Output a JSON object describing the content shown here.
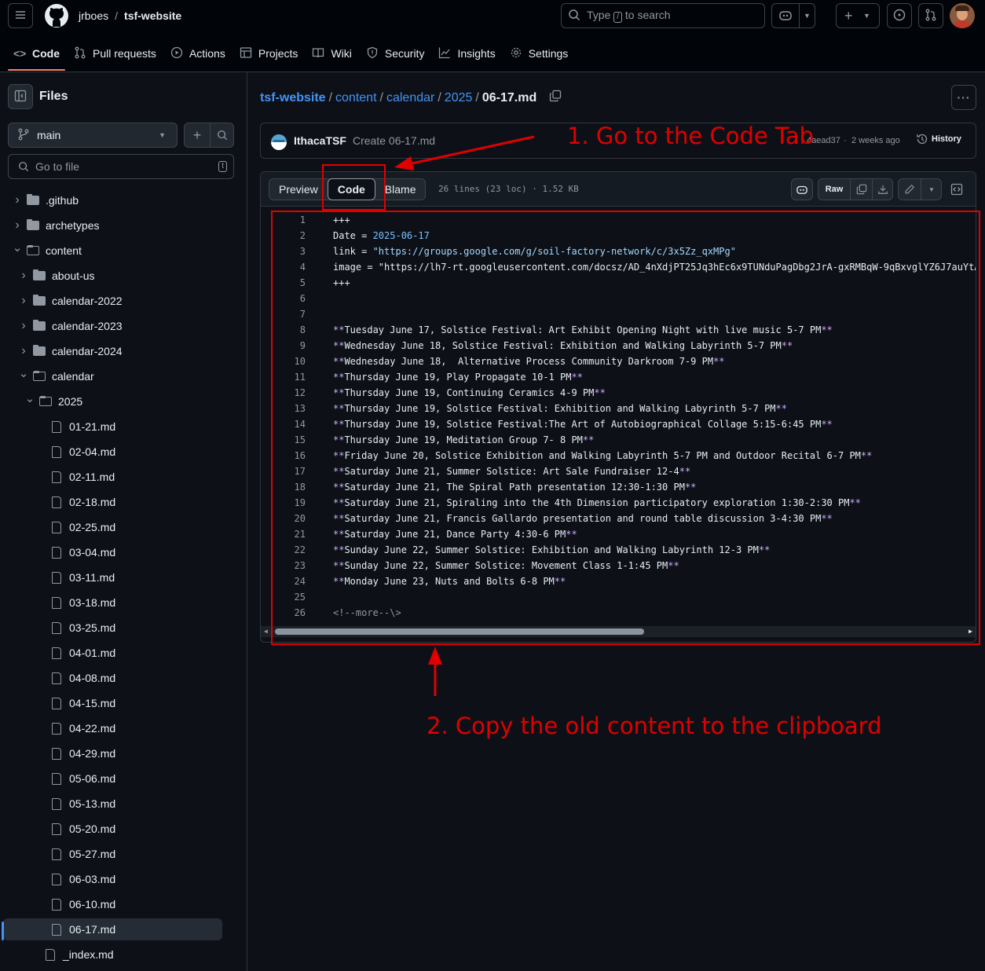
{
  "header": {
    "owner": "jrboes",
    "repo": "tsf-website",
    "search_prefix": "Type",
    "search_key": "/",
    "search_suffix": "to search"
  },
  "nav_tabs": [
    {
      "label": "Code",
      "icon": "code-icon"
    },
    {
      "label": "Pull requests",
      "icon": "pull-request-icon"
    },
    {
      "label": "Actions",
      "icon": "play-icon"
    },
    {
      "label": "Projects",
      "icon": "table-icon"
    },
    {
      "label": "Wiki",
      "icon": "book-icon"
    },
    {
      "label": "Security",
      "icon": "shield-icon"
    },
    {
      "label": "Insights",
      "icon": "graph-icon"
    },
    {
      "label": "Settings",
      "icon": "gear-icon"
    }
  ],
  "sidebar": {
    "title": "Files",
    "branch": "main",
    "goto_placeholder": "Go to file",
    "goto_key": "t",
    "tree": [
      {
        "label": ".github",
        "type": "folder",
        "depth": 0,
        "open": false
      },
      {
        "label": "archetypes",
        "type": "folder",
        "depth": 0,
        "open": false
      },
      {
        "label": "content",
        "type": "folder",
        "depth": 0,
        "open": true
      },
      {
        "label": "about-us",
        "type": "folder",
        "depth": 1,
        "open": false
      },
      {
        "label": "calendar-2022",
        "type": "folder",
        "depth": 1,
        "open": false
      },
      {
        "label": "calendar-2023",
        "type": "folder",
        "depth": 1,
        "open": false
      },
      {
        "label": "calendar-2024",
        "type": "folder",
        "depth": 1,
        "open": false
      },
      {
        "label": "calendar",
        "type": "folder",
        "depth": 1,
        "open": true
      },
      {
        "label": "2025",
        "type": "folder",
        "depth": 2,
        "open": true
      },
      {
        "label": "01-21.md",
        "type": "file",
        "depth": 3
      },
      {
        "label": "02-04.md",
        "type": "file",
        "depth": 3
      },
      {
        "label": "02-11.md",
        "type": "file",
        "depth": 3
      },
      {
        "label": "02-18.md",
        "type": "file",
        "depth": 3
      },
      {
        "label": "02-25.md",
        "type": "file",
        "depth": 3
      },
      {
        "label": "03-04.md",
        "type": "file",
        "depth": 3
      },
      {
        "label": "03-11.md",
        "type": "file",
        "depth": 3
      },
      {
        "label": "03-18.md",
        "type": "file",
        "depth": 3
      },
      {
        "label": "03-25.md",
        "type": "file",
        "depth": 3
      },
      {
        "label": "04-01.md",
        "type": "file",
        "depth": 3
      },
      {
        "label": "04-08.md",
        "type": "file",
        "depth": 3
      },
      {
        "label": "04-15.md",
        "type": "file",
        "depth": 3
      },
      {
        "label": "04-22.md",
        "type": "file",
        "depth": 3
      },
      {
        "label": "04-29.md",
        "type": "file",
        "depth": 3
      },
      {
        "label": "05-06.md",
        "type": "file",
        "depth": 3
      },
      {
        "label": "05-13.md",
        "type": "file",
        "depth": 3
      },
      {
        "label": "05-20.md",
        "type": "file",
        "depth": 3
      },
      {
        "label": "05-27.md",
        "type": "file",
        "depth": 3
      },
      {
        "label": "06-03.md",
        "type": "file",
        "depth": 3
      },
      {
        "label": "06-10.md",
        "type": "file",
        "depth": 3
      },
      {
        "label": "06-17.md",
        "type": "file",
        "depth": 3,
        "selected": true
      },
      {
        "label": "_index.md",
        "type": "file",
        "depth": 2
      }
    ]
  },
  "breadcrumb": [
    "tsf-website",
    "content",
    "calendar",
    "2025"
  ],
  "breadcrumb_current": "06-17.md",
  "commit": {
    "author": "IthacaTSF",
    "message": "Create 06-17.md",
    "sha": "4aead37",
    "age": "2 weeks ago",
    "history_label": "History"
  },
  "file_header": {
    "tabs": [
      "Preview",
      "Code",
      "Blame"
    ],
    "active_tab": "Code",
    "meta": "26 lines (23 loc) · 1.52 KB",
    "raw_label": "Raw"
  },
  "code_lines": [
    "+++",
    "Date = 2025-06-17",
    "link = \"https://groups.google.com/g/soil-factory-network/c/3x5Zz_qxMPg\"",
    "image = \"https://lh7-rt.googleusercontent.com/docsz/AD_4nXdjPT25Jq3hEc6x9TUNduPagDbg2JrA-gxRMBqW-9qBxvglYZ6J7auYtA",
    "+++",
    "",
    "",
    "**Tuesday June 17, Solstice Festival: Art Exhibit Opening Night with live music 5-7 PM**",
    "**Wednesday June 18, Solstice Festival: Exhibition and Walking Labyrinth 5-7 PM**",
    "**Wednesday June 18,  Alternative Process Community Darkroom 7-9 PM**",
    "**Thursday June 19, Play Propagate 10-1 PM**",
    "**Thursday June 19, Continuing Ceramics 4-9 PM**",
    "**Thursday June 19, Solstice Festival: Exhibition and Walking Labyrinth 5-7 PM**",
    "**Thursday June 19, Solstice Festival:The Art of Autobiographical Collage 5:15-6:45 PM**",
    "**Thursday June 19, Meditation Group 7- 8 PM**",
    "**Friday June 20, Solstice Exhibition and Walking Labyrinth 5-7 PM and Outdoor Recital 6-7 PM**",
    "**Saturday June 21, Summer Solstice: Art Sale Fundraiser 12-4**",
    "**Saturday June 21, The Spiral Path presentation 12:30-1:30 PM**",
    "**Saturday June 21, Spiraling into the 4th Dimension participatory exploration 1:30-2:30 PM**",
    "**Saturday June 21, Francis Gallardo presentation and round table discussion 3-4:30 PM**",
    "**Saturday June 21, Dance Party 4:30-6 PM**",
    "**Sunday June 22, Summer Solstice: Exhibition and Walking Labyrinth 12-3 PM**",
    "**Sunday June 22, Summer Solstice: Movement Class 1-1:45 PM**",
    "**Monday June 23, Nuts and Bolts 6-8 PM**",
    "",
    "<!--more--\\>"
  ],
  "annotations": {
    "step1": "1. Go to the Code Tab",
    "step2": "2. Copy the old content to the clipboard",
    "color": "#e00000"
  },
  "colors": {
    "accent_link": "#4493f8",
    "active_underline": "#f78166",
    "background": "#0d1117"
  }
}
